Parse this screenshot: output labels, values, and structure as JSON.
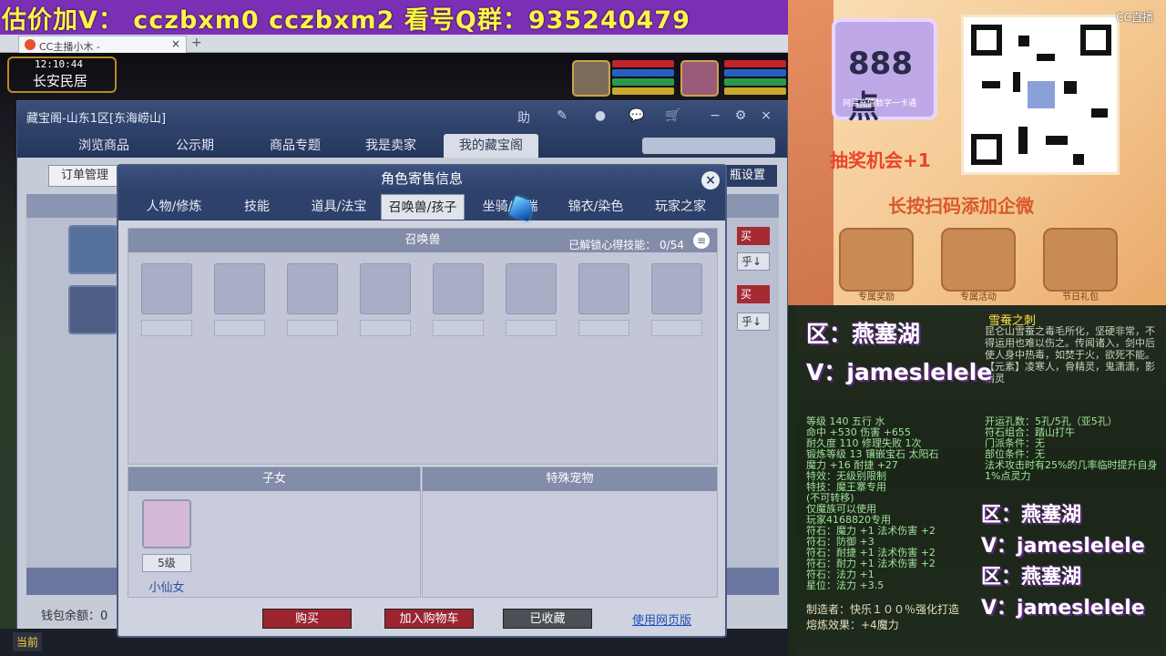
{
  "banner": {
    "text": "估价加V：  cczbxm0   cczbxm2   看号Q群：935240479"
  },
  "browser": {
    "tab_title": "CC主播小木 -",
    "close": "×",
    "new_tab": "+"
  },
  "game": {
    "clock": "12:10:44",
    "location": "长安民居"
  },
  "window": {
    "title": "藏宝阁-山东1区[东海崂山]",
    "toolbar_icons": [
      "助",
      "✎",
      "●",
      "💬",
      "🛒",
      "−",
      "⚙",
      "×"
    ],
    "nav_tabs": [
      "浏览商品",
      "公示期",
      "商品专题",
      "我是卖家",
      "我的藏宝阁"
    ],
    "order_manage": "订单管理",
    "right_setting": "瓶设置",
    "buy_small": "买",
    "sort_small": "乎↓",
    "wallet": "钱包余额：0"
  },
  "taskbar": {
    "label": "当前"
  },
  "dialog": {
    "title": "角色寄售信息",
    "close": "×",
    "tabs": [
      "人物/修炼",
      "技能",
      "道具/法宝",
      "召唤兽/孩子",
      "坐骑/祥瑞",
      "锦衣/染色",
      "玩家之家"
    ],
    "pet_header": "召唤兽",
    "pet_progress_label": "已解锁心得技能：",
    "pet_progress": "0/54",
    "menu_icon": "≡",
    "children_header": "子女",
    "special_header": "特殊宠物",
    "child": {
      "level": "5级",
      "name": "小仙女"
    },
    "buttons": {
      "buy": "购买",
      "add_cart": "加入购物车",
      "favorited": "已收藏",
      "web_link": "使用网页版"
    }
  },
  "promo": {
    "card_value": "888点",
    "card_sub": "网易充值数字一卡通",
    "draw": "抽奖机会+1",
    "scan": "长按扫码添加企微",
    "watermark": "CC直播",
    "gifts": [
      "专属奖励",
      "专属活动",
      "节日礼包"
    ]
  },
  "stream": {
    "item_name": "雪蚕之刺",
    "item_desc": "昆仑山雪蚕之毒毛所化，坚硬非常，不得运用也难以伤之。传闻诸入，剑中后使人身中热毒，如焚于火，欲死不能。【元素】凌寒人，骨精灵，鬼潇潇，影精灵",
    "stats_left": [
      "等级 140  五行 水",
      "命中 +530 伤害 +655",
      "耐久度 110  修理失败 1次",
      "锻炼等级 13  镶嵌宝石 太阳石",
      "魔力 +16 耐捷 +27",
      "特效：无级别限制",
      "特技：魔王寨专用",
      "(不可转移)",
      "仅魔族可以使用",
      "玩家4168820专用",
      "符石：魔力 +1 法术伤害 +2",
      "符石：防御 +3",
      "符石：耐捷 +1 法术伤害 +2",
      "符石：耐力 +1 法术伤害 +2",
      "符石：法力 +1",
      "星位：法力 +3.5"
    ],
    "stats_right": [
      "开运孔数：5孔/5孔（亚5孔）",
      "符石组合：踏山打牛",
      "门派条件：无",
      "部位条件：无",
      "法术攻击时有25%的几率临时提升自身1%点灵力"
    ],
    "maker": "制造者：快乐１００％强化打造",
    "effects": "熔炼效果：+4魔力",
    "overlay_zone": "区：燕塞湖",
    "overlay_v": "V：jameslelele"
  },
  "colors": {
    "banner": "#7a2fb5",
    "banner_text": "#fff34a",
    "nav": "#2e416b",
    "buy_red": "#9b2430",
    "link_blue": "#1e4fb8"
  },
  "icons": {
    "menu": "list-icon",
    "close": "close-icon",
    "cart": "cart-icon",
    "cursor": "mouse-cursor-icon"
  }
}
